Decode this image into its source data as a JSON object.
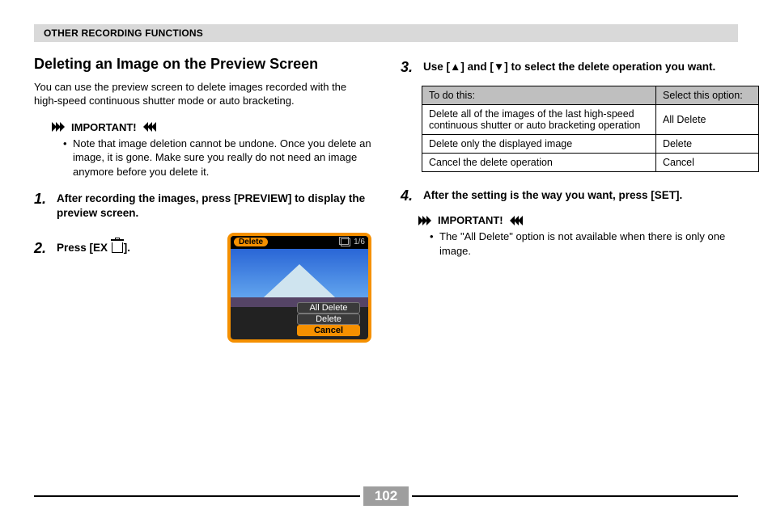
{
  "header": {
    "title": "OTHER RECORDING FUNCTIONS"
  },
  "left": {
    "heading": "Deleting an Image on the Preview Screen",
    "intro": "You can use the preview screen to delete images recorded with the high-speed continuous shutter mode or auto bracketing.",
    "important_label": "IMPORTANT!",
    "important_text": "Note that image deletion cannot be undone. Once you delete an image, it is gone. Make sure you really do not need an image anymore before you delete it.",
    "step1_num": "1.",
    "step1": "After recording the images, press [PREVIEW] to display the preview screen.",
    "step2_num": "2.",
    "step2_prefix": "Press [EX ",
    "step2_suffix": "].",
    "cam": {
      "delete_button": "Delete",
      "counter": "1/6",
      "options": [
        "All Delete",
        "Delete",
        "Cancel"
      ],
      "selected_index": 2
    }
  },
  "right": {
    "step3_num": "3.",
    "step3": "Use [▲] and [▼] to select the delete operation you want.",
    "table": {
      "head_action": "To do this:",
      "head_option": "Select this option:",
      "rows": [
        {
          "action": "Delete all of the images of the last high-speed continuous shutter or auto bracketing operation",
          "option": "All Delete"
        },
        {
          "action": "Delete only the displayed image",
          "option": "Delete"
        },
        {
          "action": "Cancel the delete operation",
          "option": "Cancel"
        }
      ]
    },
    "step4_num": "4.",
    "step4": "After the setting is the way you want, press [SET].",
    "important_label": "IMPORTANT!",
    "important_text": "The \"All Delete\" option is not available when there is only one image."
  },
  "footer": {
    "page_number": "102"
  }
}
